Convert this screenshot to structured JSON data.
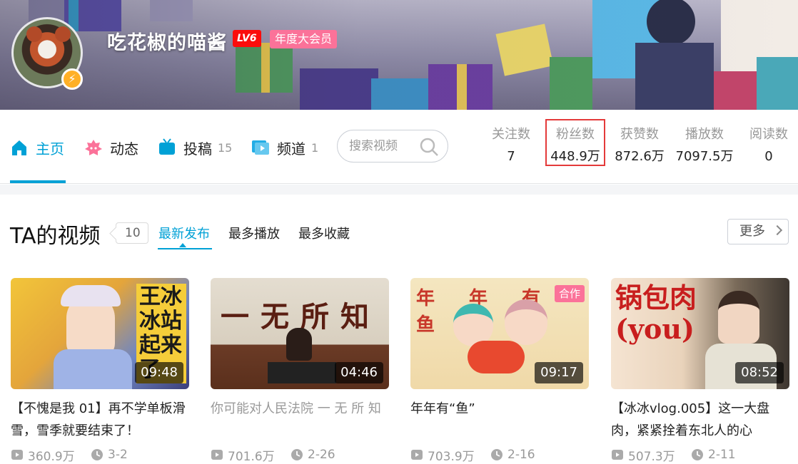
{
  "user": {
    "name": "吃花椒的喵酱",
    "level": "LV6",
    "vip": "年度大会员"
  },
  "nav": {
    "items": [
      {
        "label": "主页",
        "count": ""
      },
      {
        "label": "动态",
        "count": ""
      },
      {
        "label": "投稿",
        "count": "15"
      },
      {
        "label": "频道",
        "count": "1"
      }
    ],
    "search_placeholder": "搜索视频"
  },
  "stats": [
    {
      "label": "关注数",
      "value": "7"
    },
    {
      "label": "粉丝数",
      "value": "448.9万"
    },
    {
      "label": "获赞数",
      "value": "872.6万"
    },
    {
      "label": "播放数",
      "value": "7097.5万"
    },
    {
      "label": "阅读数",
      "value": "0"
    }
  ],
  "videos_section": {
    "title": "TA的视频",
    "count": "10",
    "tabs": [
      "最新发布",
      "最多播放",
      "最多收藏"
    ],
    "more_label": "更多"
  },
  "videos": [
    {
      "title": "【不愧是我 01】再不学单板滑雪，雪季就要结束了！",
      "duration": "09:48",
      "plays": "360.9万",
      "date": "3-2",
      "thumb_text": "王冰冰站起来了"
    },
    {
      "title": "你可能对人民法院 一 无 所 知",
      "duration": "04:46",
      "plays": "701.6万",
      "date": "2-26",
      "thumb_text": "一无所知"
    },
    {
      "title": "年年有“鱼”",
      "duration": "09:17",
      "plays": "703.9万",
      "date": "2-16",
      "badge": "合作",
      "thumb_text": "年年有鱼"
    },
    {
      "title": "【冰冰vlog.005】这一大盘肉，紧紧拴着东北人的心",
      "duration": "08:52",
      "plays": "507.3万",
      "date": "2-11",
      "thumb_text": "锅包肉(you)"
    }
  ],
  "colors": {
    "accent": "#00a1d6",
    "pink": "#fb7299",
    "highlight_box": "#e43a3a"
  }
}
